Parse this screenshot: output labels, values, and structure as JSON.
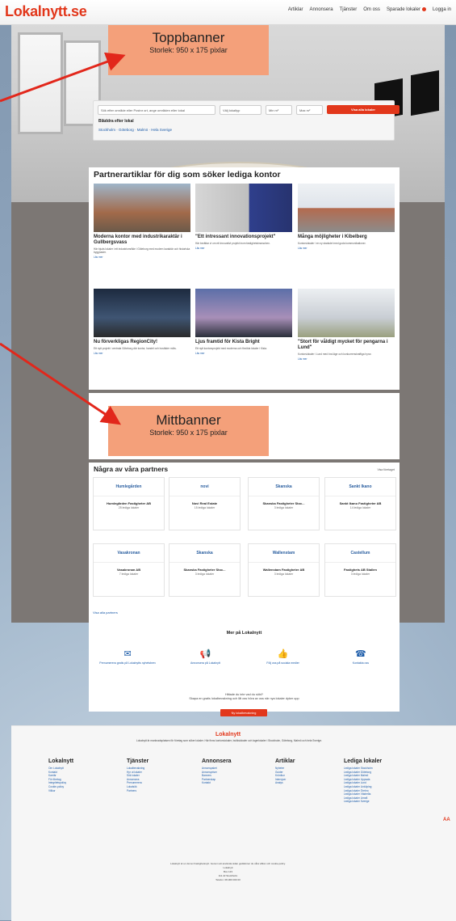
{
  "nav": {
    "logo": "Lokalnytt.se",
    "links": [
      "Artiklar",
      "Annonsera",
      "Tjänster",
      "Om oss",
      "Sparade lokaler",
      "Logga in"
    ]
  },
  "banners": {
    "top": {
      "title": "Toppbanner",
      "size": "Storlek: 950 x 175 pixlar"
    },
    "mid": {
      "title": "Mittbanner",
      "size": "Storlek: 950 x 175 pixlar"
    }
  },
  "search": {
    "placeholder": "Sök efter område eller Postnr ort, ange områden eller lokal",
    "type_label": "Välj lokaltyp",
    "min_label": "Min m²",
    "max_label": "Max m²",
    "button": "Visa alla lokaler",
    "heading": "Bläddra efter lokal",
    "cities": "Stockholm · Göteborg · Malmö · Hela Sverige"
  },
  "content": {
    "heading": "Partnerartiklar för dig som söker lediga kontor",
    "articles": [
      {
        "title": "Moderna kontor med industrikaraktär i Gullbergsvass",
        "desc": "Här bjuds lokaler i ett industriområde i Göteborg med modern karaktär och historiska byggnader.",
        "more": "Läs mer"
      },
      {
        "title": "\"Ett intressant innovationsprojekt\"",
        "desc": "Här berättar vi om ett innovativt projekt inom fastighetsbranschen.",
        "more": "Läs mer"
      },
      {
        "title": "Många möjligheter i Kibelberg",
        "desc": "Kontorslokaler i en ny stadsdel med goda kommunikationer.",
        "more": "Läs mer"
      },
      {
        "title": "Nu förverkligas RegionCity!",
        "desc": "Ett nytt projekt i centrala Göteborg där kontor, handel och bostäder möts.",
        "more": "Läs mer"
      },
      {
        "title": "Ljus framtid för Kista Bright",
        "desc": "Ett nytt kontorsprojekt med moderna och flexibla lokaler i Kista.",
        "more": "Läs mer"
      },
      {
        "title": "\"Stort för våldigt mycket för pengarna i Lund\"",
        "desc": "Kontorslokaler i Lund med bra läge och konkurrenskraftiga hyror.",
        "more": "Läs mer"
      }
    ]
  },
  "partners": {
    "heading": "Några av våra partners",
    "right_link": "Visa företaget",
    "items": [
      {
        "logo": "Humlegården",
        "name": "Humlegården Fastigheter AB",
        "count": "25 lediga lokaler"
      },
      {
        "logo": "novi",
        "name": "Novi Real Estate",
        "count": "15 lediga lokaler"
      },
      {
        "logo": "Skanska",
        "name": "Skanska Fastigheter Stoc...",
        "count": "3 lediga lokaler"
      },
      {
        "logo": "Sankt Ikano",
        "name": "Sankt Ikano Fastigheter AB",
        "count": "14 lediga lokaler"
      },
      {
        "logo": "Vasakronan",
        "name": "Vasakronan AB",
        "count": "7 lediga lokaler"
      },
      {
        "logo": "Skanska",
        "name": "Skanska Fastigheter Stoc...",
        "count": "3 lediga lokaler"
      },
      {
        "logo": "Wallenstam",
        "name": "Wallenstam Fastigheter AB",
        "count": "3 lediga lokaler"
      },
      {
        "logo": "Castellum",
        "name": "Fastighets AB Stallen",
        "count": "3 lediga lokaler"
      }
    ],
    "all_link": "Visa alla partners",
    "why_heading": "Mer på Lokalnytt",
    "why_items": [
      "Prenumerera gratis på Lokalnytts nyhetsbrev",
      "Annonsera på Lokalnytt",
      "Följ oss på sociala medier",
      "Kontakta oss"
    ],
    "contact_q1": "Hittade du inte vad du sökt?",
    "contact_q2": "Skapa en gratis lokalbevakning och låt oss höra av oss när nya lokaler dyker upp",
    "contact_btn": "Ny lokalbevakning"
  },
  "footer": {
    "logo": "Lokalnytt",
    "text": "Lokalnytt är marknadsplatsen för företag som söker lokaler. Här finns kontorslokaler, butikslokaler och lagerlokaler i Stockholm, Göteborg, Malmö och hela Sverige.",
    "cols": [
      {
        "head": "Lokalnytt",
        "links": [
          "Om Lokalnytt",
          "Kontakt",
          "Karriär",
          "För företag",
          "Integritetspolicy",
          "Cookie-policy",
          "Villkor"
        ]
      },
      {
        "head": "Tjänster",
        "links": [
          "Lokalbevakning",
          "Hyr ut lokaler",
          "Sök lokaler",
          "Annonsera",
          "Prenumerera",
          "Lokalsök",
          "Partners"
        ]
      },
      {
        "head": "Annonsera",
        "links": [
          "Annonspaket",
          "Annonspriser",
          "Banners",
          "Partnerskap",
          "Kontakt"
        ]
      },
      {
        "head": "Artiklar",
        "links": [
          "Nyheter",
          "Guider",
          "Krönikor",
          "Intervjuer",
          "Analys"
        ]
      },
      {
        "head": "Lediga lokaler",
        "links": [
          "Lediga lokaler Stockholm",
          "Lediga lokaler Göteborg",
          "Lediga lokaler Malmö",
          "Lediga lokaler Uppsala",
          "Lediga lokaler Lund",
          "Lediga lokaler Linköping",
          "Lediga lokaler Örebro",
          "Lediga lokaler Västerås",
          "Lediga lokaler Umeå",
          "Lediga lokaler Sverige"
        ]
      }
    ],
    "bottom": [
      "Lokalnytt är en del av Fastighetsnytt. Genom att använda sidan godkänner du våra villkor och cookie-policy.",
      "Lokalnytt",
      "Box 123",
      "111 22 Stockholm",
      "Telefon: 08-000 000 00"
    ],
    "mark": "AA"
  },
  "colors": {
    "accent": "#e2371b",
    "banner": "#f4a07a",
    "link": "#1a5aa8"
  }
}
